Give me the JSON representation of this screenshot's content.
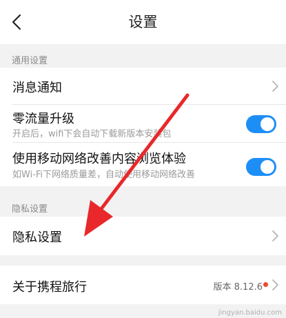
{
  "nav": {
    "title": "设置",
    "back_icon": "chevron-left-icon"
  },
  "sections": {
    "general_title": "通用设置",
    "privacy_title": "隐私设置"
  },
  "rows": {
    "notifications": {
      "label": "消息通知"
    },
    "zero_data_upgrade": {
      "label": "零流量升级",
      "subtitle": "开启后，wifi下会自动下载新版本安装包",
      "enabled": true
    },
    "mobile_network": {
      "label": "使用移动网络改善内容浏览体验",
      "subtitle": "如Wi-Fi下网络质量差，自动使用移动网络改善",
      "enabled": true
    },
    "privacy": {
      "label": "隐私设置"
    },
    "about": {
      "label": "关于携程旅行",
      "version": "版本 8.12.6"
    }
  },
  "colors": {
    "toggle_on": "#1e8ef7",
    "badge_dot": "#f04a2e",
    "annotation_arrow": "#e8282b"
  },
  "watermark": "jingyan.baidu.com"
}
